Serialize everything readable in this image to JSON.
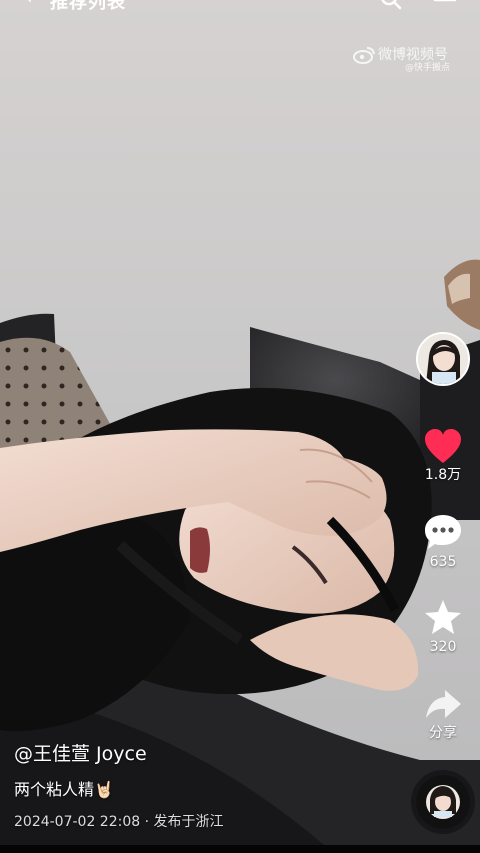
{
  "top_bar": {
    "back_icon": "chevron-left-icon",
    "title": "推荐列表",
    "search_icon": "search-icon",
    "more_icon": "more-icon"
  },
  "watermark": {
    "logo_icon": "weibo-logo-icon",
    "text": "微博视频号",
    "sub_text": "@快手搬点"
  },
  "side_actions": {
    "creator_avatar_icon": "creator-avatar-icon",
    "like": {
      "icon": "heart-icon",
      "count": "1.8万",
      "color": "#ff2c55"
    },
    "comment": {
      "icon": "comment-icon",
      "count": "635"
    },
    "favorite": {
      "icon": "star-icon",
      "count": "320"
    },
    "share": {
      "icon": "share-arrow-icon",
      "label": "分享"
    }
  },
  "caption": {
    "author": "@王佳萱 Joyce",
    "description": "两个粘人精🤘🏻",
    "meta": "2024-07-02 22:08 · 发布于浙江"
  },
  "music_disc": {
    "icon": "music-disc-icon"
  }
}
